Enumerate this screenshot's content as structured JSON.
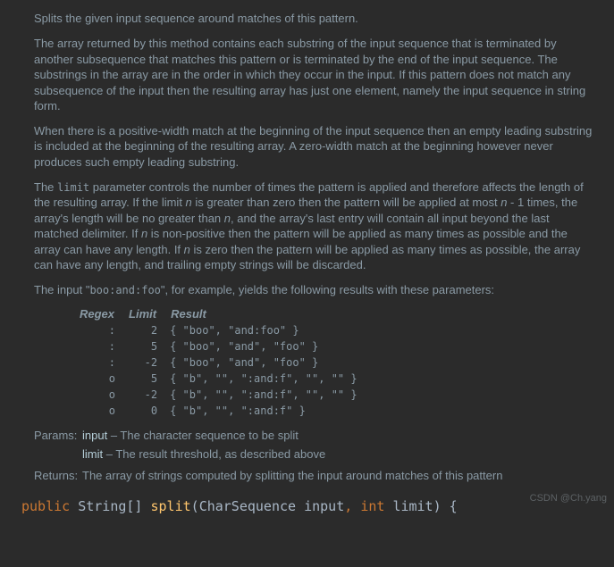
{
  "para1": "Splits the given input sequence around matches of this pattern.",
  "para2": "The array returned by this method contains each substring of the input sequence that is terminated by another subsequence that matches this pattern or is terminated by the end of the input sequence. The substrings in the array are in the order in which they occur in the input. If this pattern does not match any subsequence of the input then the resulting array has just one element, namely the input sequence in string form.",
  "para3": "When there is a positive-width match at the beginning of the input sequence then an empty leading substring is included at the beginning of the resulting array. A zero-width match at the beginning however never produces such empty leading substring.",
  "limit_sentence": {
    "t0": "The ",
    "code0": "limit",
    "t1": " parameter controls the number of times the pattern is applied and therefore affects the length of the resulting array. If the limit ",
    "n1": "n",
    "t2": " is greater than zero then the pattern will be applied at most ",
    "n2": "n",
    "t3": " - 1 times, the array's length will be no greater than ",
    "n3": "n",
    "t4": ", and the array's last entry will contain all input beyond the last matched delimiter. If ",
    "n4": "n",
    "t5": " is non-positive then the pattern will be applied as many times as possible and the array can have any length. If ",
    "n5": "n",
    "t6": " is zero then the pattern will be applied as many times as possible, the array can have any length, and trailing empty strings will be discarded."
  },
  "example_intro": {
    "t0": "The input \"",
    "code0": "boo:and:foo",
    "t1": "\", for example, yields the following results with these parameters:"
  },
  "table": {
    "hdr_regex": "Regex",
    "hdr_limit": "Limit",
    "hdr_result": "Result",
    "rows": [
      {
        "regex": ":",
        "limit": "2",
        "result": "{ \"boo\", \"and:foo\" }"
      },
      {
        "regex": ":",
        "limit": "5",
        "result": "{ \"boo\", \"and\", \"foo\" }"
      },
      {
        "regex": ":",
        "limit": "-2",
        "result": "{ \"boo\", \"and\", \"foo\" }"
      },
      {
        "regex": "o",
        "limit": "5",
        "result": "{ \"b\", \"\", \":and:f\", \"\", \"\" }"
      },
      {
        "regex": "o",
        "limit": "-2",
        "result": "{ \"b\", \"\", \":and:f\", \"\", \"\" }"
      },
      {
        "regex": "o",
        "limit": "0",
        "result": "{ \"b\", \"\", \":and:f\" }"
      }
    ]
  },
  "params_label": "Params:",
  "param_input_name": "input",
  "param_input_desc": " – The character sequence to be split",
  "param_limit_name": "limit",
  "param_limit_desc": " – The result threshold, as described above",
  "returns_label": "Returns:",
  "returns_desc": "The array of strings computed by splitting the input around matches of this pattern",
  "code": {
    "kw_public": "public",
    "type_string": "String",
    "brackets": "[]",
    "method": "split",
    "paren_open": "(",
    "type_cs": "CharSequence",
    "arg_input": "input",
    "comma": ",",
    "kw_int": "int",
    "arg_limit": "limit",
    "paren_close": ")",
    "brace": "{"
  },
  "watermark": "CSDN @Ch.yang"
}
